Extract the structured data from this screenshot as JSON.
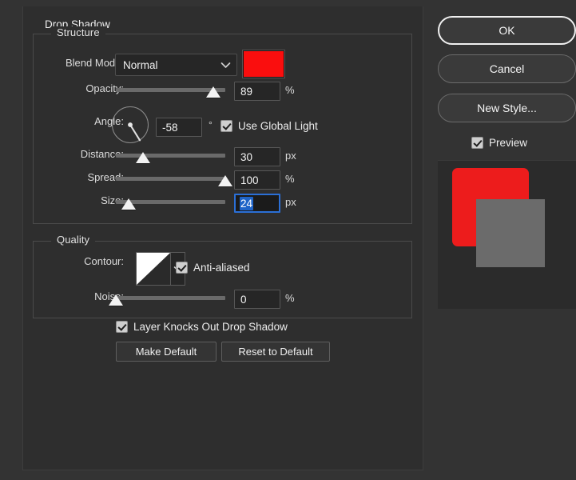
{
  "dialog": {
    "heading": "Drop Shadow"
  },
  "structure": {
    "title": "Structure",
    "blend_mode": {
      "label": "Blend Mode:",
      "value": "Normal",
      "color_swatch": "#fa0e0e",
      "chevron_icon": "chevron-down-icon"
    },
    "opacity": {
      "label": "Opacity:",
      "value": "89",
      "unit": "%",
      "slider_percent": 89
    },
    "angle": {
      "label": "Angle:",
      "value": "-58",
      "unit": "°",
      "degrees": -58,
      "dial_icon": "angle-dial-icon"
    },
    "use_global_light": {
      "label": "Use Global Light",
      "checked": true
    },
    "distance": {
      "label": "Distance:",
      "value": "30",
      "unit": "px",
      "slider_percent": 25
    },
    "spread": {
      "label": "Spread:",
      "value": "100",
      "unit": "%",
      "slider_percent": 100
    },
    "size": {
      "label": "Size:",
      "value": "24",
      "unit": "px",
      "slider_percent": 12,
      "focused": true,
      "text_selected": true
    }
  },
  "quality": {
    "title": "Quality",
    "contour": {
      "label": "Contour:",
      "swatch_icon": "contour-linear-icon",
      "chevron_icon": "chevron-down-icon"
    },
    "anti_aliased": {
      "label": "Anti-aliased",
      "checked": true
    },
    "noise": {
      "label": "Noise:",
      "value": "0",
      "unit": "%",
      "slider_percent": 0
    }
  },
  "footer": {
    "layer_knocks_out": {
      "label": "Layer Knocks Out Drop Shadow",
      "checked": true
    },
    "make_default": "Make Default",
    "reset_to_default": "Reset to Default"
  },
  "side_panel": {
    "ok": "OK",
    "cancel": "Cancel",
    "new_style": "New Style...",
    "preview": {
      "label": "Preview",
      "checked": true
    },
    "thumbnail": {
      "shape_color": "#ed1c1c",
      "shadow_color": "#6b6b6b"
    }
  }
}
